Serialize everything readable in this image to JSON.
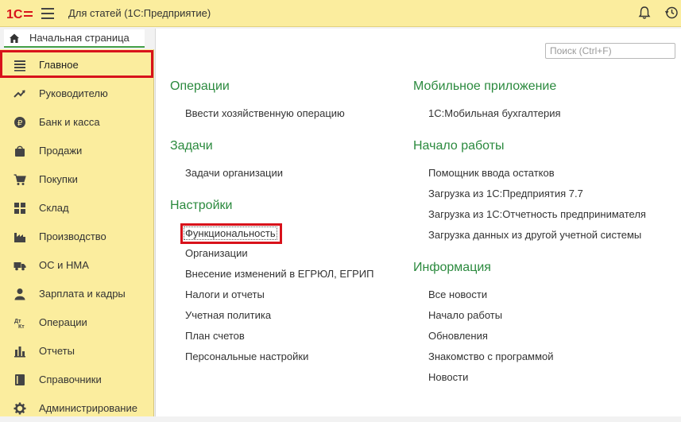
{
  "app": {
    "title": "Для статей  (1С:Предприятие)",
    "logo_text": "1С",
    "brand_color": "#d8121b",
    "accent_color": "#2b8a3e"
  },
  "home_tab": {
    "label": "Начальная страница",
    "icon": "home-icon"
  },
  "sidebar": {
    "items": [
      {
        "label": "Главное",
        "icon": "list-icon",
        "active": true
      },
      {
        "label": "Руководителю",
        "icon": "trend-icon"
      },
      {
        "label": "Банк и касса",
        "icon": "ruble-coin-icon"
      },
      {
        "label": "Продажи",
        "icon": "bag-icon"
      },
      {
        "label": "Покупки",
        "icon": "cart-icon"
      },
      {
        "label": "Склад",
        "icon": "grid-icon"
      },
      {
        "label": "Производство",
        "icon": "factory-icon"
      },
      {
        "label": "ОС и НМА",
        "icon": "truck-icon"
      },
      {
        "label": "Зарплата и кадры",
        "icon": "person-icon"
      },
      {
        "label": "Операции",
        "icon": "dt-kt-icon"
      },
      {
        "label": "Отчеты",
        "icon": "bar-chart-icon"
      },
      {
        "label": "Справочники",
        "icon": "book-icon"
      },
      {
        "label": "Администрирование",
        "icon": "gear-icon"
      }
    ],
    "dt_label": "Дт",
    "kt_label": "Кт"
  },
  "search": {
    "placeholder": "Поиск (Ctrl+F)",
    "value": ""
  },
  "sections": {
    "operations": {
      "title": "Операции",
      "links": [
        "Ввести хозяйственную операцию"
      ]
    },
    "tasks": {
      "title": "Задачи",
      "links": [
        "Задачи организации"
      ]
    },
    "settings": {
      "title": "Настройки",
      "links": [
        "Функциональность",
        "Организации",
        "Внесение изменений в ЕГРЮЛ, ЕГРИП",
        "Налоги и отчеты",
        "Учетная политика",
        "План счетов",
        "Персональные настройки"
      ]
    },
    "mobile": {
      "title": "Мобильное приложение",
      "links": [
        "1С:Мобильная бухгалтерия"
      ]
    },
    "start": {
      "title": "Начало работы",
      "links": [
        "Помощник ввода остатков",
        "Загрузка из 1С:Предприятия 7.7",
        "Загрузка из 1С:Отчетность предпринимателя",
        "Загрузка данных из другой учетной системы"
      ]
    },
    "info": {
      "title": "Информация",
      "links": [
        "Все новости",
        "Начало работы",
        "Обновления",
        "Знакомство с программой",
        "Новости"
      ]
    }
  }
}
